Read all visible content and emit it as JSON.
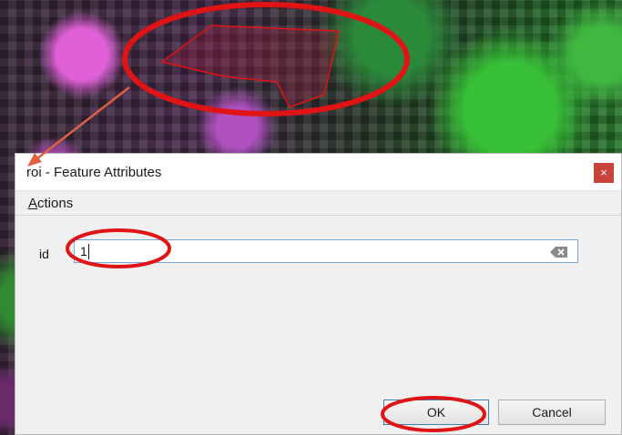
{
  "dialog": {
    "title": "roi - Feature Attributes",
    "close_glyph": "×"
  },
  "menu": {
    "actions_accel": "A",
    "actions_rest": "ctions"
  },
  "form": {
    "id_label": "id",
    "id_value": "1"
  },
  "buttons": {
    "ok_label": "OK",
    "cancel_label": "Cancel"
  },
  "colors": {
    "annotation": "#e01414",
    "close_button": "#c9433a",
    "field_focus_border": "#7aa7d6"
  },
  "icons": {
    "clear": "clear-text-icon",
    "close": "close-icon"
  }
}
